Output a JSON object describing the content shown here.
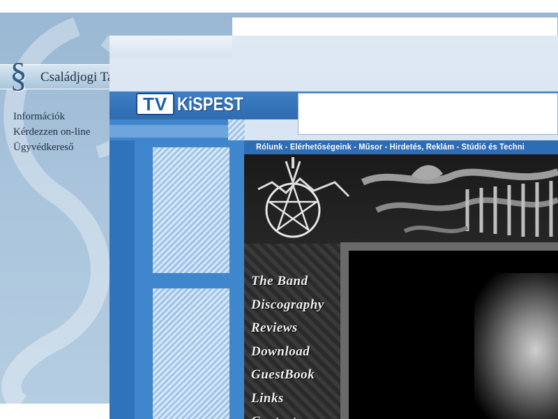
{
  "legal_site": {
    "logo_symbol": "§",
    "title": "Családjogi Tanácsadó",
    "nav": [
      "Információk",
      "Kérdezzen on-line",
      "Ügyvédkereső"
    ]
  },
  "tv_site": {
    "logo_tv": "TV",
    "logo_name": "KiSPEST",
    "nav_text": "Rólunk - Elérhetőségeink - Műsor - Hirdetés, Reklám - Stúdió és Techni"
  },
  "band_site": {
    "menu": [
      "The Band",
      "Discography",
      "Reviews",
      "Download",
      "GuestBook",
      "Links",
      "Contact"
    ]
  },
  "colors": {
    "legal_bg": "#a9c4dc",
    "tv_blue": "#3f86cc",
    "band_bg": "#0d0d0d"
  }
}
